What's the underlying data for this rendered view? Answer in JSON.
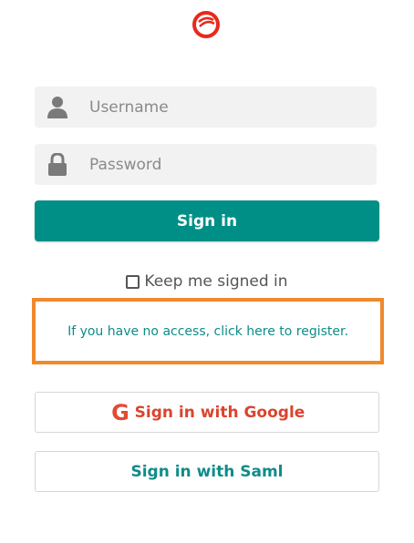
{
  "icons": {
    "logo": "sonarqube-swirl-logo-icon",
    "username": "user-icon",
    "password": "lock-icon",
    "google": "google-g-icon"
  },
  "colors": {
    "accent": "#008f87",
    "highlight_border": "#f0892c",
    "google_red": "#d9452e",
    "link_teal": "#0e8c8a"
  },
  "form": {
    "username_placeholder": "Username",
    "password_placeholder": "Password",
    "signin_label": "Sign in",
    "keep_signed_in_label": "Keep me signed in",
    "keep_signed_in_checked": false,
    "register_link": "If you have no access, click here to register."
  },
  "alt_login": {
    "google_icon_text": "G",
    "google_label": "Sign in with Google",
    "saml_label": "Sign in with Saml"
  }
}
